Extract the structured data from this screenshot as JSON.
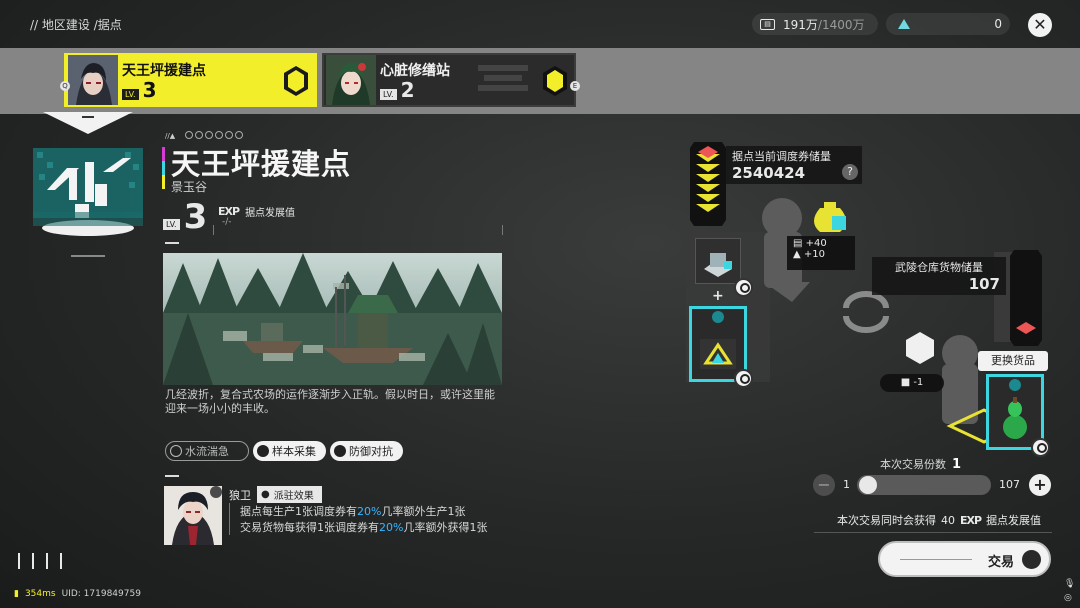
{
  "breadcrumb": "// 地区建设  /据点",
  "header": {
    "currency_value": "191万",
    "currency_cap": "/1400万",
    "tokens_value": "0"
  },
  "tabs": [
    {
      "name": "天王坪援建点",
      "lv_tag": "LV.",
      "level": "3",
      "key": "Q",
      "active": true
    },
    {
      "name": "心脏修缮站",
      "lv_tag": "LV.",
      "level": "2",
      "key": "E",
      "active": false
    }
  ],
  "outpost": {
    "title": "天王坪援建点",
    "region": "景玉谷",
    "lv_tag": "LV.",
    "level": "3",
    "dev_key": "EXP",
    "dev_label": "据点发展值",
    "dev_value": "-/-",
    "description": "几经波折，复合式农场的运作逐渐步入正轨。假以时日，或许这里能迎来一场小小的丰收。",
    "tags": [
      "水流湍急",
      "样本采集",
      "防御对抗"
    ]
  },
  "operator": {
    "name": "狼卫",
    "badge": "派驻效果",
    "line1_a": "据点每生产1张调度券有",
    "line1_pct": "20%",
    "line1_b": "几率额外生产1张",
    "line2_a": "交易货物每获得1张调度券有",
    "line2_pct": "20%",
    "line2_b": "几率额外获得1张"
  },
  "trade": {
    "store_label": "据点当前调度券储量",
    "store_value": "2540424",
    "help": "?",
    "bonus1": "+40",
    "bonus2": "+10",
    "plus": "+",
    "warehouse_label": "武陵仓库货物储量",
    "warehouse_value": "107",
    "swap_label": "更换货品",
    "cost": "-1",
    "qty_label": "本次交易份数",
    "qty_value": "1",
    "slider_min": "1",
    "slider_max": "107",
    "slider_fraction": 0.0,
    "gain_label": "本次交易同时会获得",
    "gain_value": "40",
    "gain_key": "EXP",
    "gain_suffix": "据点发展值",
    "trade_button": "交易"
  },
  "footer": {
    "ping": "354ms",
    "uid": "UID: 1719849759"
  },
  "colors": {
    "accent_yellow": "#f2ee2a",
    "accent_cyan": "#3bd6e0",
    "highlight_blue": "#38b6ff",
    "magenta": "#d63bd6"
  }
}
